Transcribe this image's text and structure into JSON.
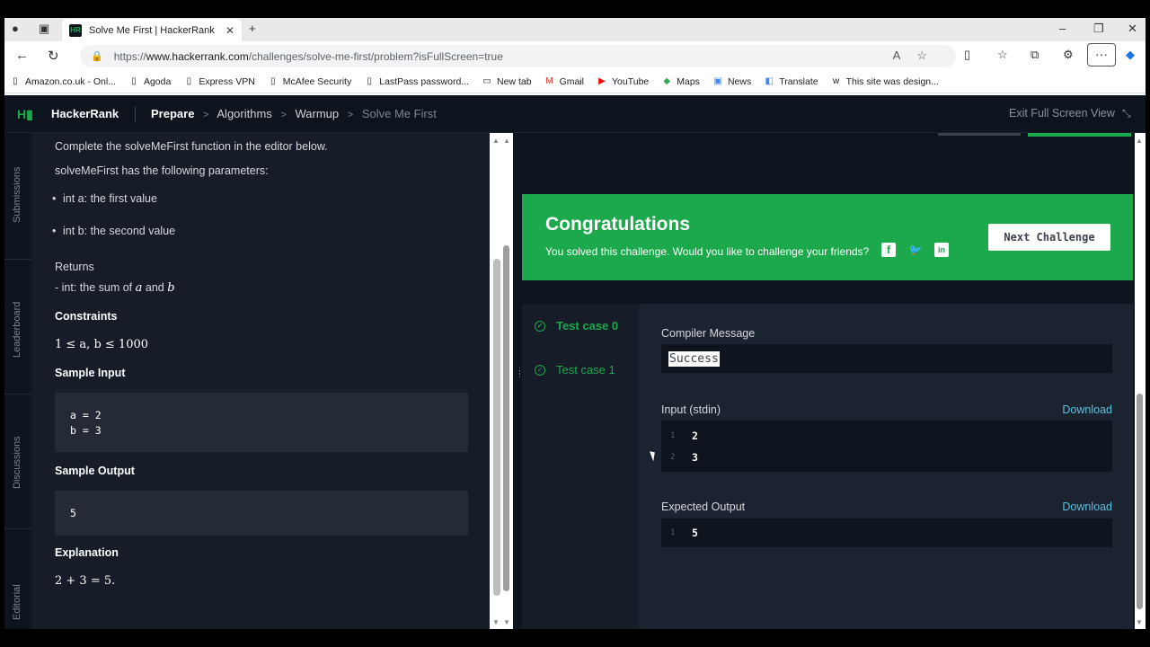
{
  "browser": {
    "tab_title": "Solve Me First | HackerRank",
    "tab_favicon": "HR",
    "url_prefix": "https://",
    "url_host": "www.hackerrank.com",
    "url_path": "/challenges/solve-me-first/problem?isFullScreen=true",
    "bookmarks": [
      {
        "label": "Amazon.co.uk - Onl...",
        "icon": "page-icon"
      },
      {
        "label": "Agoda",
        "icon": "page-icon"
      },
      {
        "label": "Express VPN",
        "icon": "page-icon"
      },
      {
        "label": "McAfee Security",
        "icon": "page-icon"
      },
      {
        "label": "LastPass password...",
        "icon": "page-icon"
      },
      {
        "label": "New tab",
        "icon": "newtab-icon"
      },
      {
        "label": "Gmail",
        "icon": "gmail-icon"
      },
      {
        "label": "YouTube",
        "icon": "youtube-icon"
      },
      {
        "label": "Maps",
        "icon": "maps-icon"
      },
      {
        "label": "News",
        "icon": "news-icon"
      },
      {
        "label": "Translate",
        "icon": "translate-icon"
      },
      {
        "label": "This site was design...",
        "icon": "wix-icon"
      }
    ]
  },
  "header": {
    "brand": "HackerRank",
    "crumb_prepare": "Prepare",
    "crumb_algorithms": "Algorithms",
    "crumb_warmup": "Warmup",
    "crumb_current": "Solve Me First",
    "exit_fullscreen": "Exit Full Screen View"
  },
  "vtabs": {
    "submissions": "Submissions",
    "leaderboard": "Leaderboard",
    "discussions": "Discussions",
    "editorial": "Editorial"
  },
  "problem": {
    "intro": "Complete the solveMeFirst function in the editor below.",
    "params_heading": "solveMeFirst has the following parameters:",
    "param_a": "int a: the first value",
    "param_b": "int b: the second value",
    "returns_heading": "Returns",
    "returns_desc": "- int: the sum of",
    "returns_a": "a",
    "returns_and": "and",
    "returns_b": "b",
    "constraints_heading": "Constraints",
    "constraints_math": "1 ≤ a, b ≤ 1000",
    "sample_input_heading": "Sample Input",
    "sample_input_line1": "a = 2",
    "sample_input_line2": "b = 3",
    "sample_output_heading": "Sample Output",
    "sample_output": "5",
    "explanation_heading": "Explanation",
    "explanation_math": "2 + 3 = 5."
  },
  "result": {
    "congrats_title": "Congratulations",
    "congrats_sub": "You solved this challenge. Would you like to challenge your friends?",
    "next_button": "Next Challenge",
    "testcase0": "Test case 0",
    "testcase1": "Test case 1",
    "compiler_label": "Compiler Message",
    "compiler_msg": "Success",
    "input_label": "Input (stdin)",
    "download": "Download",
    "input_lines": [
      {
        "n": "1",
        "v": "2"
      },
      {
        "n": "2",
        "v": "3"
      }
    ],
    "expected_label": "Expected Output",
    "expected_lines": [
      {
        "n": "1",
        "v": "5"
      }
    ]
  },
  "colors": {
    "accent_green": "#1ba94c",
    "link_blue": "#5bc0de",
    "bg_dark": "#0e141e"
  }
}
